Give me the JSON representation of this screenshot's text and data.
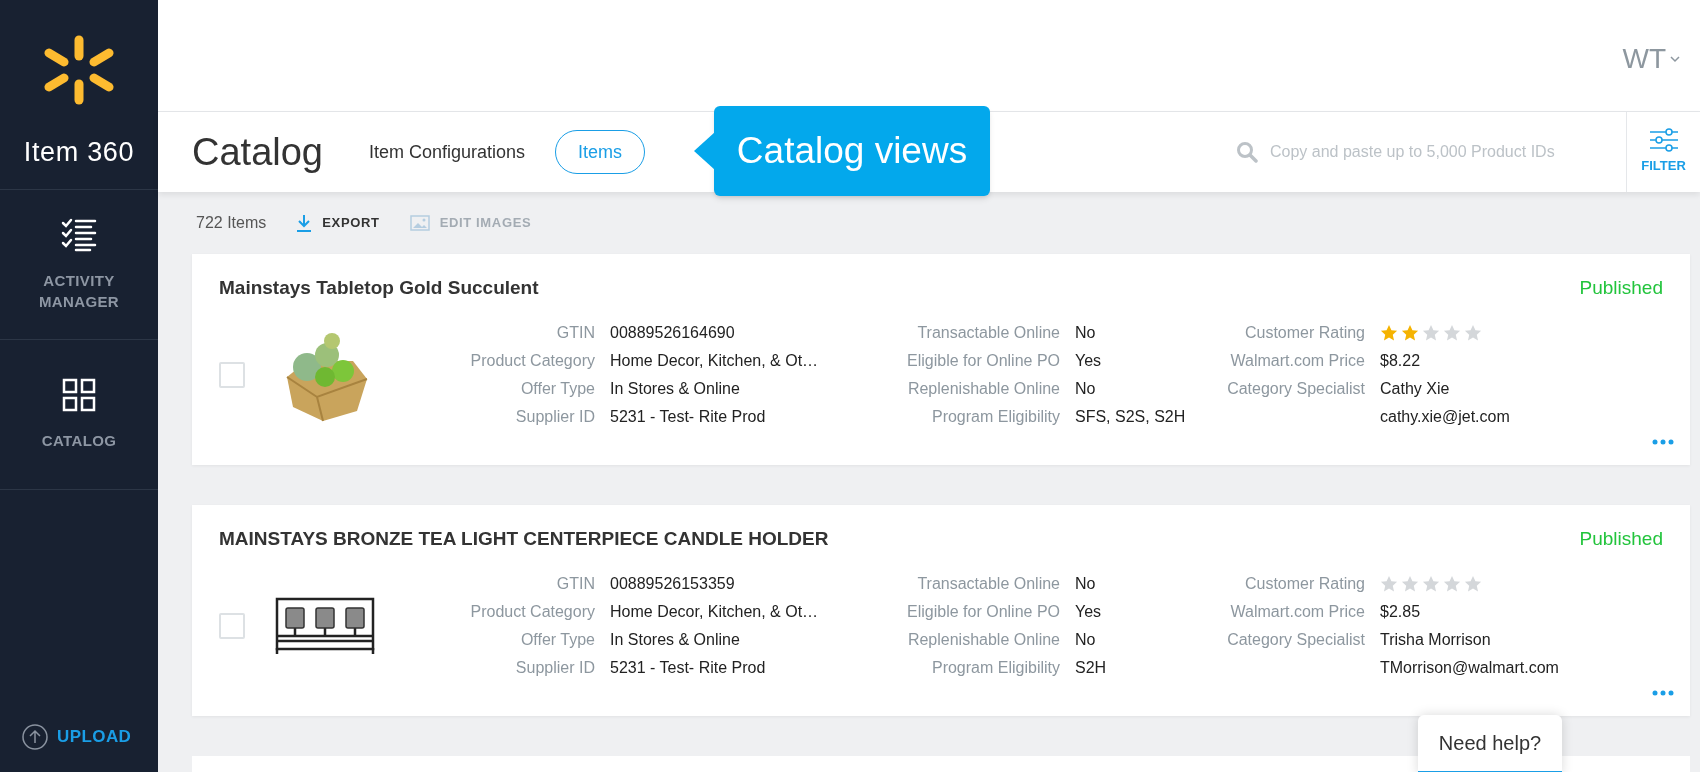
{
  "sidebar": {
    "app_name": "Item 360",
    "nav": [
      {
        "label": "ACTIVITY MANAGER",
        "kind": "checklist"
      },
      {
        "label": "CATALOG",
        "kind": "grid"
      }
    ],
    "upload": "UPLOAD"
  },
  "header": {
    "user": "WT"
  },
  "catalog_bar": {
    "title": "Catalog",
    "views": [
      {
        "label": "Item Configurations",
        "selected": false
      },
      {
        "label": "Items",
        "selected": true
      }
    ],
    "tooltip": "Catalog views",
    "search": {
      "placeholder": "Copy and paste up to 5,000 Product IDs"
    },
    "filter": "FILTER"
  },
  "toolbar": {
    "count": "722 Items",
    "actions": [
      {
        "label": "EXPORT",
        "kind": "download",
        "disabled": false
      },
      {
        "label": "EDIT IMAGES",
        "kind": "image",
        "disabled": true
      }
    ]
  },
  "items": [
    {
      "title": "Mainstays Tabletop Gold Succulent",
      "status": "Published",
      "checked": false,
      "kind": "succulent",
      "fields": [
        [
          {
            "label": "GTIN",
            "value": "00889526164690"
          },
          {
            "label": "Product Category",
            "value": "Home Decor, Kitchen, & Ot…"
          },
          {
            "label": "Offer Type",
            "value": "In Stores & Online"
          },
          {
            "label": "Supplier ID",
            "value": "5231 - Test- Rite Prod"
          }
        ],
        [
          {
            "label": "Transactable Online",
            "value": "No"
          },
          {
            "label": "Eligible for Online PO",
            "value": "Yes"
          },
          {
            "label": "Replenishable Online",
            "value": "No"
          },
          {
            "label": "Program Eligibility",
            "value": "SFS, S2S, S2H"
          }
        ]
      ],
      "rating_label": "Customer Rating",
      "stars": 2,
      "price_label": "Walmart.com Price",
      "price": "$8.22",
      "specialist_label": "Category Specialist",
      "specialist": "Cathy Xie",
      "email": "cathy.xie@jet.com"
    },
    {
      "title": "MAINSTAYS BRONZE TEA LIGHT CENTERPIECE CANDLE HOLDER",
      "status": "Published",
      "checked": false,
      "kind": "candle-holder",
      "fields": [
        [
          {
            "label": "GTIN",
            "value": "00889526153359"
          },
          {
            "label": "Product Category",
            "value": "Home Decor, Kitchen, & Ot…"
          },
          {
            "label": "Offer Type",
            "value": "In Stores & Online"
          },
          {
            "label": "Supplier ID",
            "value": "5231 - Test- Rite Prod"
          }
        ],
        [
          {
            "label": "Transactable Online",
            "value": "No"
          },
          {
            "label": "Eligible for Online PO",
            "value": "Yes"
          },
          {
            "label": "Replenishable Online",
            "value": "No"
          },
          {
            "label": "Program Eligibility",
            "value": "S2H"
          }
        ]
      ],
      "rating_label": "Customer Rating",
      "stars": 0,
      "price_label": "Walmart.com Price",
      "price": "$2.85",
      "specialist_label": "Category Specialist",
      "specialist": "Trisha Morrison",
      "email": "TMorrison@walmart.com"
    }
  ],
  "help": "Need help?"
}
